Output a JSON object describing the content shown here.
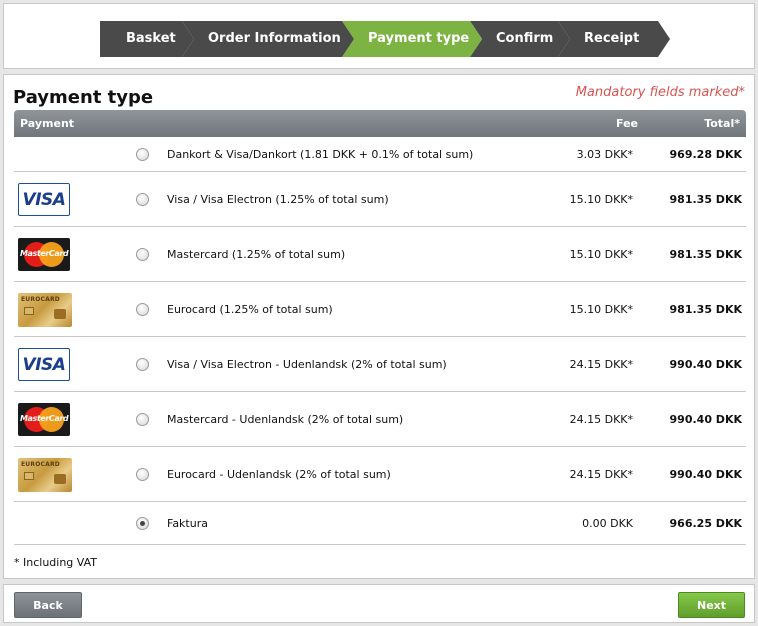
{
  "steps": [
    {
      "label": "Basket",
      "active": false
    },
    {
      "label": "Order Information",
      "active": false
    },
    {
      "label": "Payment type",
      "active": true
    },
    {
      "label": "Confirm",
      "active": false
    },
    {
      "label": "Receipt",
      "active": false
    }
  ],
  "page": {
    "title": "Payment type",
    "mandatory_note": "Mandatory fields marked*"
  },
  "table": {
    "headers": {
      "payment": "Payment",
      "fee": "Fee",
      "total": "Total*"
    },
    "rows": [
      {
        "logo": "none",
        "label": "Dankort & Visa/Dankort (1.81 DKK + 0.1% of total sum)",
        "fee": "3.03 DKK*",
        "total": "969.28 DKK",
        "selected": false
      },
      {
        "logo": "visa",
        "label": "Visa / Visa Electron (1.25% of total sum)",
        "fee": "15.10 DKK*",
        "total": "981.35 DKK",
        "selected": false
      },
      {
        "logo": "mastercard",
        "label": "Mastercard (1.25% of total sum)",
        "fee": "15.10 DKK*",
        "total": "981.35 DKK",
        "selected": false
      },
      {
        "logo": "eurocard",
        "label": "Eurocard (1.25% of total sum)",
        "fee": "15.10 DKK*",
        "total": "981.35 DKK",
        "selected": false
      },
      {
        "logo": "visa",
        "label": "Visa / Visa Electron - Udenlandsk (2% of total sum)",
        "fee": "24.15 DKK*",
        "total": "990.40 DKK",
        "selected": false
      },
      {
        "logo": "mastercard",
        "label": "Mastercard - Udenlandsk (2% of total sum)",
        "fee": "24.15 DKK*",
        "total": "990.40 DKK",
        "selected": false
      },
      {
        "logo": "eurocard",
        "label": "Eurocard - Udenlandsk (2% of total sum)",
        "fee": "24.15 DKK*",
        "total": "990.40 DKK",
        "selected": false
      },
      {
        "logo": "none",
        "label": "Faktura",
        "fee": "0.00 DKK",
        "total": "966.25 DKK",
        "selected": true
      }
    ]
  },
  "vat_note": "* Including VAT",
  "logo_text": {
    "visa": "VISA",
    "mastercard": "MasterCard",
    "eurocard": "EUROCARD"
  },
  "nav": {
    "back_label": "Back",
    "next_label": "Next"
  },
  "colors": {
    "active_step": "#7cb342",
    "step": "#4a4a4a",
    "mandatory": "#d9534f",
    "next_button": "#6fb33a"
  }
}
